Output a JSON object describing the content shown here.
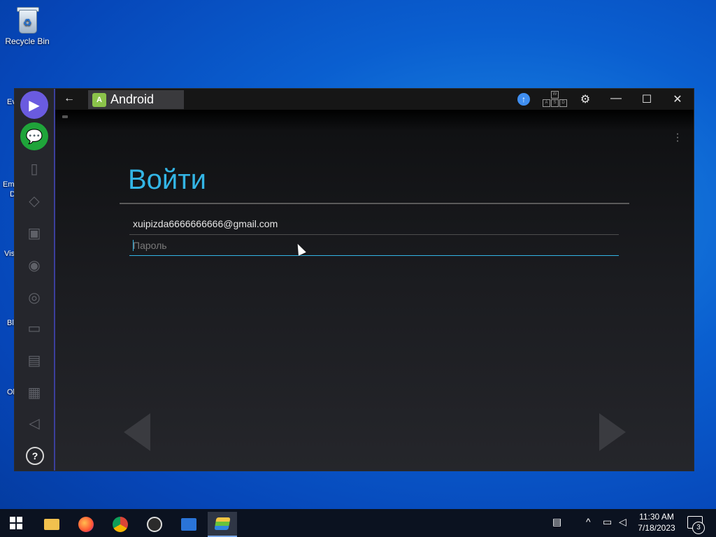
{
  "desktop": {
    "recycle_bin_label": "Recycle Bin",
    "partial_labels": [
      "Ev",
      "Em",
      "D",
      "Vis",
      "Bl",
      "Ol"
    ]
  },
  "window": {
    "tab_title": "Android",
    "android_logo_text": "A",
    "icons": {
      "back": "back-arrow-icon",
      "upload": "upload-icon",
      "keys": "keyboard-mapping-icon",
      "settings": "gear-icon",
      "minimize": "minimize-icon",
      "maximize": "maximize-icon",
      "close": "close-icon"
    },
    "key_letters": [
      "W",
      "A",
      "S",
      "D"
    ]
  },
  "sidebar": {
    "help_label": "?"
  },
  "screen": {
    "heading": "Войти",
    "email_value": "xuipizda6666666666@gmail.com",
    "password_placeholder": "Пароль",
    "password_value": ""
  },
  "taskbar": {
    "time": "11:30 AM",
    "date": "7/18/2023",
    "notification_count": "3"
  },
  "colors": {
    "accent": "#33b5e5",
    "desktop_blue": "#0a5fd0",
    "sidebar_bg": "#25262c"
  }
}
